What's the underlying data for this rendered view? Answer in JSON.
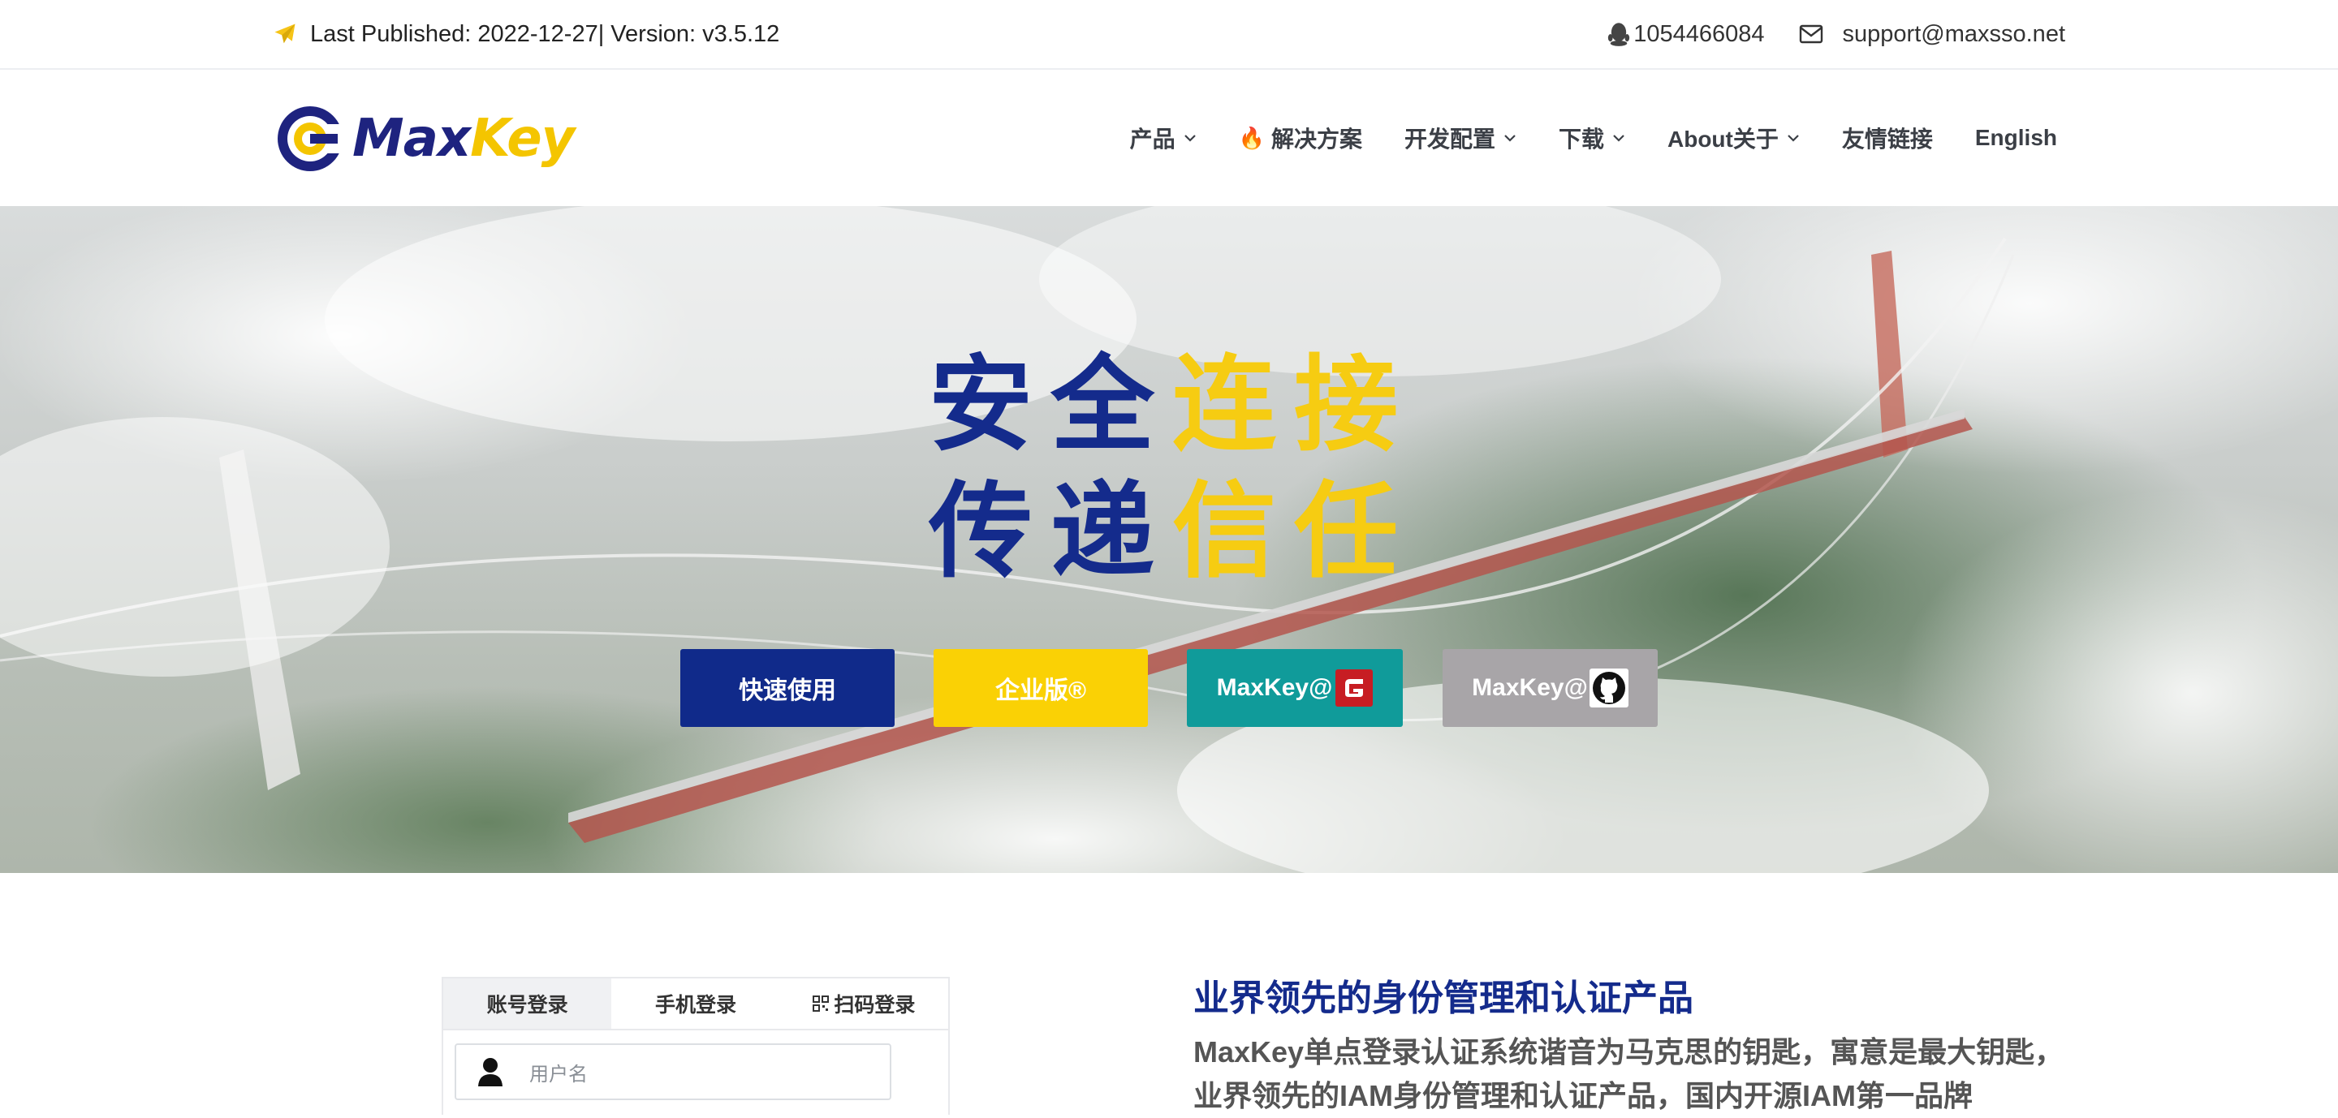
{
  "topbar": {
    "publish_info": "Last Published: 2022-12-27| Version: v3.5.12",
    "qq": "1054466084",
    "email": "support@maxsso.net"
  },
  "logo": {
    "part1": "Max",
    "part2": "Key"
  },
  "nav": {
    "products": "产品",
    "solutions": "解决方案",
    "dev_config": "开发配置",
    "download": "下载",
    "about": "About关于",
    "links": "友情链接",
    "english": "English"
  },
  "hero": {
    "line1_a": "安全",
    "line1_b": "连接",
    "line2_a": "传递",
    "line2_b": "信任",
    "quick_start": "快速使用",
    "enterprise": "企业版®",
    "gitee": "MaxKey@",
    "github": "MaxKey@"
  },
  "login": {
    "tab_account": "账号登录",
    "tab_phone": "手机登录",
    "tab_scan": "扫码登录",
    "username_placeholder": "用户名"
  },
  "intro": {
    "title": "业界领先的身份管理和认证产品",
    "line1": "MaxKey单点登录认证系统谐音为马克思的钥匙，寓意是最大钥匙，",
    "line2": "业界领先的IAM身份管理和认证产品，国内开源IAM第一品牌"
  },
  "colors": {
    "brand_blue": "#142b8c",
    "brand_yellow": "#f6cc12",
    "teal": "#109b9a",
    "gray_button": "#a8a5a8"
  }
}
